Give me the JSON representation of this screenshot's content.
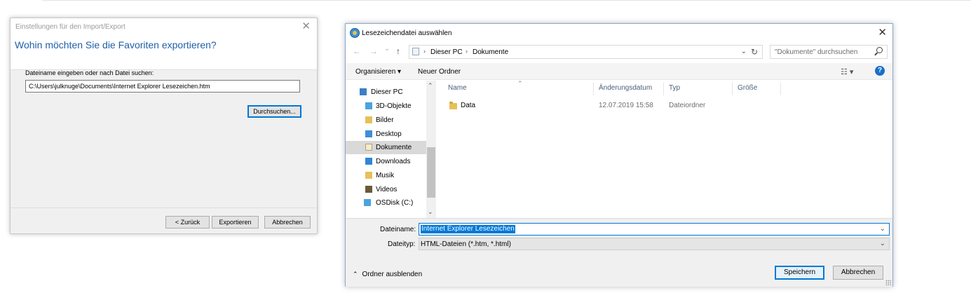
{
  "dialog1": {
    "title": "Einstellungen für den Import/Export",
    "heading": "Wohin möchten Sie die Favoriten exportieren?",
    "file_label": "Dateiname eingeben oder nach Datei suchen:",
    "file_path": "C:\\Users\\julknuge\\Documents\\Internet Explorer Lesezeichen.htm",
    "browse_label": "Durchsuchen...",
    "back_label": "< Zurück",
    "export_label": "Exportieren",
    "cancel_label": "Abbrechen",
    "close_glyph": "✕"
  },
  "dialog2": {
    "title": "Lesezeichendatei auswählen",
    "close_glyph": "✕",
    "nav": {
      "back": "←",
      "forward": "→",
      "dropdown": "⌄",
      "up": "↑"
    },
    "address": {
      "crumbs": [
        "Dieser PC",
        "Dokumente"
      ],
      "separator": "›",
      "dropdown": "⌄",
      "refresh": "↻"
    },
    "search_placeholder": "\"Dokumente\" durchsuchen",
    "toolbar": {
      "organize": "Organisieren ▾",
      "new_folder": "Neuer Ordner",
      "view_icon": "☷ ▾",
      "help": "?"
    },
    "nav_items": [
      {
        "label": "Dieser PC",
        "icon": "pc-icon",
        "color": "#3b7fc4"
      },
      {
        "label": "3D-Objekte",
        "icon": "3d-objects-icon",
        "color": "#4aa3df"
      },
      {
        "label": "Bilder",
        "icon": "pictures-icon",
        "color": "#e6c15a"
      },
      {
        "label": "Desktop",
        "icon": "desktop-icon",
        "color": "#3d8fd6"
      },
      {
        "label": "Dokumente",
        "icon": "documents-icon",
        "color": "#e8d9a8"
      },
      {
        "label": "Downloads",
        "icon": "downloads-icon",
        "color": "#2f86d6"
      },
      {
        "label": "Musik",
        "icon": "music-icon",
        "color": "#e6c15a"
      },
      {
        "label": "Videos",
        "icon": "videos-icon",
        "color": "#6a5a3a"
      },
      {
        "label": "OSDisk (C:)",
        "icon": "drive-icon",
        "color": "#4aa3df"
      }
    ],
    "columns": {
      "name": "Name",
      "date": "Änderungsdatum",
      "type": "Typ",
      "size": "Größe"
    },
    "files": [
      {
        "name": "Data",
        "date": "12.07.2019 15:58",
        "type": "Dateiordner",
        "size": ""
      }
    ],
    "filename_label": "Dateiname:",
    "filename_value": "Internet Explorer Lesezeichen",
    "filetype_label": "Dateityp:",
    "filetype_value": "HTML-Dateien (*.htm, *.html)",
    "field_dropdown": "⌄",
    "hide_folders": "Ordner ausblenden",
    "hide_caret": "⌃",
    "save_label": "Speichern",
    "cancel_label": "Abbrechen"
  }
}
